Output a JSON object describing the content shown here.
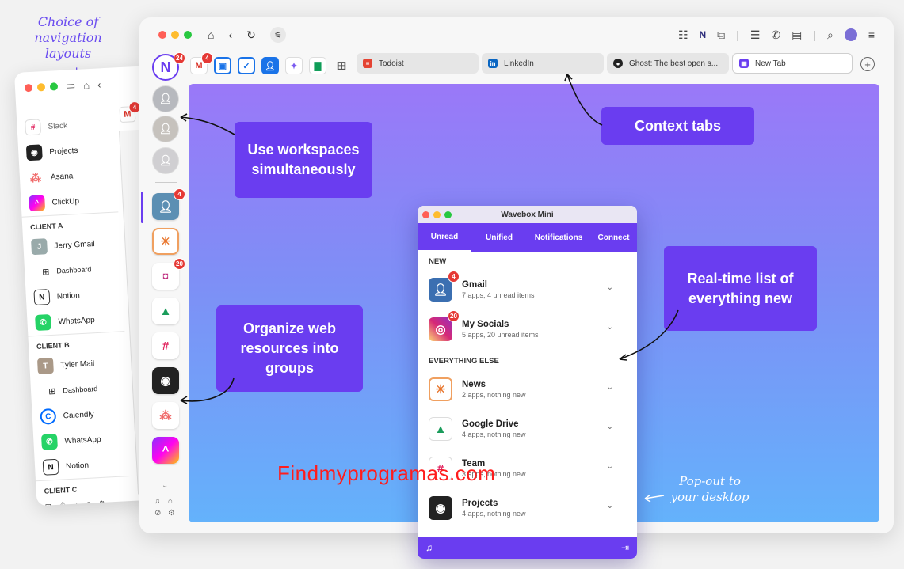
{
  "annotations": {
    "nav_layouts": "Choice of navigation layouts",
    "popout": "Pop-out to your desktop"
  },
  "callouts": {
    "workspaces": "Use workspaces simultaneously",
    "context_tabs": "Context tabs",
    "organize": "Organize web resources into groups",
    "realtime": "Real-time list of everything new"
  },
  "watermark": "Findmyprogramas.com",
  "side_window": {
    "items": [
      {
        "label": "Slack",
        "logo": "slack-logo"
      },
      {
        "label": "Projects",
        "logo": "github-logo"
      },
      {
        "label": "Asana",
        "logo": "asana-logo"
      },
      {
        "label": "ClickUp",
        "logo": "clickup-logo"
      }
    ],
    "client_a": {
      "title": "CLIENT A",
      "items": [
        "Jerry Gmail",
        "Dashboard",
        "Notion",
        "WhatsApp"
      ]
    },
    "client_b": {
      "title": "CLIENT B",
      "items": [
        "Tyler Mail",
        "Dashboard",
        "Calendly",
        "WhatsApp",
        "Notion"
      ]
    },
    "client_c": {
      "title": "CLIENT C"
    },
    "gmail_badge": "4"
  },
  "browser": {
    "logo_badge": "24",
    "gmail_badge": "4",
    "tabs": [
      {
        "label": "Todoist",
        "icon": "todoist-icon",
        "color": "#e44332"
      },
      {
        "label": "LinkedIn",
        "icon": "linkedin-icon",
        "color": "#0a66c2"
      },
      {
        "label": "Ghost: The best open s...",
        "icon": "ghost-icon",
        "color": "#222222"
      },
      {
        "label": "New Tab",
        "icon": "wavebox-icon",
        "color": "#6a3df0"
      }
    ],
    "rail_badges": {
      "person": "4",
      "socials": "20"
    }
  },
  "mini": {
    "title": "Wavebox Mini",
    "tabs": [
      "Unread",
      "Unified",
      "Notifications",
      "Connect"
    ],
    "section_new": "NEW",
    "section_else": "EVERYTHING ELSE",
    "new_items": [
      {
        "name": "Gmail",
        "sub": "7 apps, 4 unread items",
        "badge": "4"
      },
      {
        "name": "My Socials",
        "sub": "5 apps, 20 unread items",
        "badge": "20"
      }
    ],
    "else_items": [
      {
        "name": "News",
        "sub": "2 apps, nothing new"
      },
      {
        "name": "Google Drive",
        "sub": "4 apps, nothing new"
      },
      {
        "name": "Team",
        "sub": "3 apps, nothing new"
      },
      {
        "name": "Projects",
        "sub": "4 apps, nothing new"
      }
    ]
  },
  "colors": {
    "accent": "#6a3df0",
    "badge": "#e53935"
  }
}
